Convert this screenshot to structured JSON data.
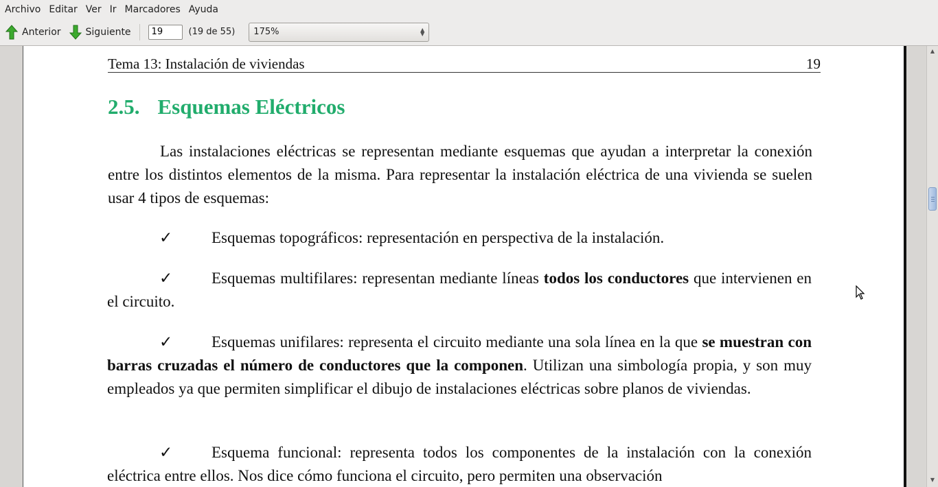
{
  "menubar": {
    "items": [
      "Archivo",
      "Editar",
      "Ver",
      "Ir",
      "Marcadores",
      "Ayuda"
    ]
  },
  "toolbar": {
    "prev_label": "Anterior",
    "next_label": "Siguiente",
    "page_value": "19",
    "page_count": "(19 de 55)",
    "zoom_value": "175%"
  },
  "document": {
    "running_header": {
      "left": "Tema 13: Instalación de viviendas",
      "right": "19"
    },
    "section": {
      "number": "2.5.",
      "title": "Esquemas Eléctricos"
    },
    "intro": "Las instalaciones eléctricas se representan mediante esquemas que ayudan a interpretar la conexión entre los distintos elementos de la misma. Para representar la instalación eléctrica de una vivienda se suelen usar 4 tipos de esquemas:",
    "bullets": [
      {
        "check": "✓",
        "text": "Esquemas topográficos: representación en perspectiva de la instalación."
      },
      {
        "check": "✓",
        "text_before": "Esquemas multifilares: representan mediante líneas ",
        "bold": "todos los conductores",
        "text_after": " que intervienen en el circuito."
      },
      {
        "check": "✓",
        "text_before": "Esquemas unifilares: representa el circuito mediante una sola línea en la que ",
        "bold": "se muestran con barras cruzadas el número de conductores que la componen",
        "text_after": ". Utilizan una simbología propia, y son muy empleados ya que permiten simplificar el dibujo de instalaciones eléctricas sobre planos de viviendas."
      },
      {
        "check": "✓",
        "text": "Esquema funcional: representa todos los componentes de la instalación con la conexión eléctrica entre ellos. Nos dice cómo funciona el circuito, pero permiten una observación"
      }
    ]
  },
  "colors": {
    "heading": "#21ac6c",
    "arrow_green": "#3caa2e"
  }
}
